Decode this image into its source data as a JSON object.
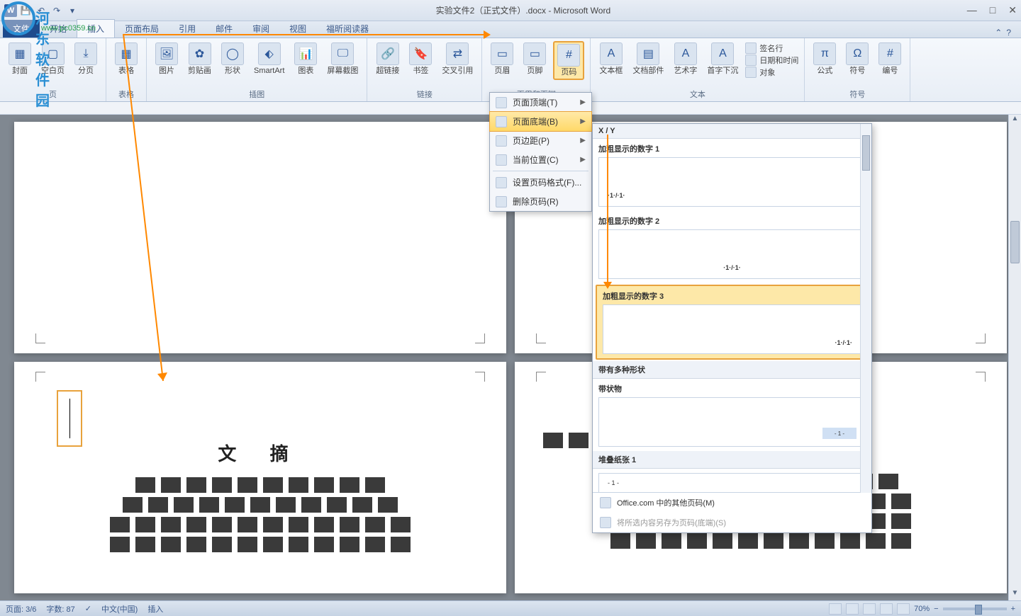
{
  "app": {
    "title": "实验文件2（正式文件）.docx - Microsoft Word",
    "window": {
      "min": "—",
      "max": "□",
      "close": "✕"
    }
  },
  "qat": {
    "save": "💾",
    "undo": "↶",
    "redo": "↷"
  },
  "tabs": {
    "file": "文件",
    "list": [
      "开始",
      "插入",
      "页面布局",
      "引用",
      "邮件",
      "审阅",
      "视图",
      "福昕阅读器"
    ],
    "active_index": 1
  },
  "ribbon": {
    "groups": [
      {
        "label": "页",
        "items": [
          {
            "name": "cover-page",
            "label": "封面",
            "glyph": "▦"
          },
          {
            "name": "blank-page",
            "label": "空白页",
            "glyph": "▢"
          },
          {
            "name": "page-break",
            "label": "分页",
            "glyph": "⤓"
          }
        ]
      },
      {
        "label": "表格",
        "items": [
          {
            "name": "table",
            "label": "表格",
            "glyph": "▦"
          }
        ]
      },
      {
        "label": "插图",
        "items": [
          {
            "name": "picture",
            "label": "图片",
            "glyph": "🖼"
          },
          {
            "name": "clipart",
            "label": "剪贴画",
            "glyph": "✿"
          },
          {
            "name": "shapes",
            "label": "形状",
            "glyph": "◯"
          },
          {
            "name": "smartart",
            "label": "SmartArt",
            "glyph": "⬖"
          },
          {
            "name": "chart",
            "label": "图表",
            "glyph": "📊"
          },
          {
            "name": "screenshot",
            "label": "屏幕截图",
            "glyph": "🖵"
          }
        ]
      },
      {
        "label": "链接",
        "items": [
          {
            "name": "hyperlink",
            "label": "超链接",
            "glyph": "🔗"
          },
          {
            "name": "bookmark",
            "label": "书签",
            "glyph": "🔖"
          },
          {
            "name": "crossref",
            "label": "交叉引用",
            "glyph": "⇄"
          }
        ]
      },
      {
        "label": "页眉和页脚",
        "items": [
          {
            "name": "header",
            "label": "页眉",
            "glyph": "▭"
          },
          {
            "name": "footer",
            "label": "页脚",
            "glyph": "▭"
          },
          {
            "name": "page-number",
            "label": "页码",
            "glyph": "#",
            "highlighted": true
          }
        ]
      },
      {
        "label": "文本",
        "items": [
          {
            "name": "textbox",
            "label": "文本框",
            "glyph": "A"
          },
          {
            "name": "quickparts",
            "label": "文档部件",
            "glyph": "▤"
          },
          {
            "name": "wordart",
            "label": "艺术字",
            "glyph": "A"
          },
          {
            "name": "dropcap",
            "label": "首字下沉",
            "glyph": "A"
          }
        ],
        "side": [
          {
            "name": "signature",
            "label": "签名行"
          },
          {
            "name": "datetime",
            "label": "日期和时间"
          },
          {
            "name": "object",
            "label": "对象"
          }
        ]
      },
      {
        "label": "符号",
        "items": [
          {
            "name": "equation",
            "label": "公式",
            "glyph": "π"
          },
          {
            "name": "symbol",
            "label": "符号",
            "glyph": "Ω"
          },
          {
            "name": "number",
            "label": "编号",
            "glyph": "#"
          }
        ]
      }
    ]
  },
  "pagenum_menu": {
    "items": [
      {
        "name": "top",
        "label": "页面顶端(T)",
        "arrow": true
      },
      {
        "name": "bottom",
        "label": "页面底端(B)",
        "arrow": true,
        "highlighted": true
      },
      {
        "name": "margin",
        "label": "页边距(P)",
        "arrow": true
      },
      {
        "name": "current",
        "label": "当前位置(C)",
        "arrow": true
      },
      {
        "sep": true
      },
      {
        "name": "format",
        "label": "设置页码格式(F)..."
      },
      {
        "name": "remove",
        "label": "删除页码(R)"
      }
    ]
  },
  "gallery": {
    "header0": "X / Y",
    "items": [
      {
        "name": "bold1",
        "title": "加粗显示的数字 1",
        "sample": "·1·/·1·",
        "align": "left"
      },
      {
        "name": "bold2",
        "title": "加粗显示的数字 2",
        "sample": "·1·/·1·",
        "align": "center"
      },
      {
        "name": "bold3",
        "title": "加粗显示的数字 3",
        "sample": "·1·/·1·",
        "align": "right",
        "selected": true
      }
    ],
    "header1": "带有多种形状",
    "items2": [
      {
        "name": "ribbon1",
        "title": "带状物",
        "sample": "- 1 -",
        "shape": true
      }
    ],
    "header2": "堆叠纸张 1",
    "items3": [
      {
        "name": "stack1",
        "title": "",
        "sample": "- 1 -"
      }
    ],
    "footer": {
      "office": "Office.com 中的其他页码(M)",
      "save_sel": "将所选内容另存为页码(底端)(S)"
    }
  },
  "document": {
    "page3_title": "文 摘"
  },
  "status": {
    "page": "页面: 3/6",
    "words": "字数: 87",
    "lang": "中文(中国)",
    "mode": "插入",
    "zoom": "70%"
  },
  "watermark": {
    "brand": "河东软件园",
    "url": "www.pc0359.cn"
  }
}
